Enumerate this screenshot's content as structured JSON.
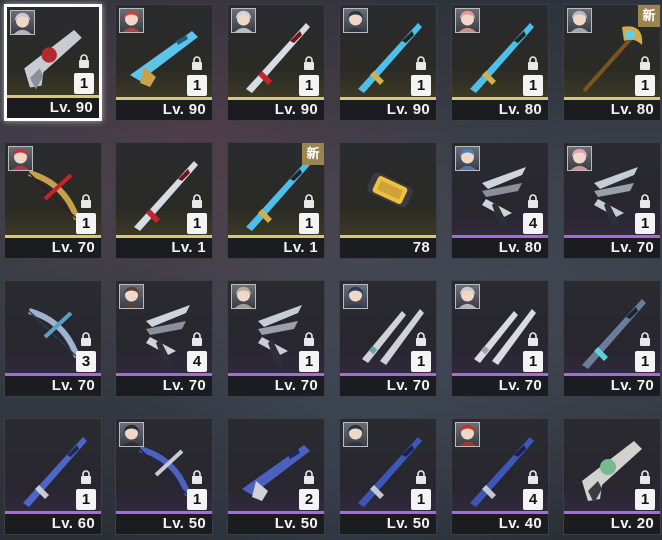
{
  "inventory": {
    "items": [
      {
        "level": "Lv. 90",
        "count": "1",
        "locked": true,
        "rarity": "gold",
        "weapon": "revolver-red",
        "avatar": "female-white",
        "avatar_color": "#c8c8d0",
        "selected": true,
        "new": false
      },
      {
        "level": "Lv. 90",
        "count": "1",
        "locked": true,
        "rarity": "gold",
        "weapon": "rifle-cyan",
        "avatar": "female-red",
        "avatar_color": "#c0463a",
        "selected": false,
        "new": false
      },
      {
        "level": "Lv. 90",
        "count": "1",
        "locked": true,
        "rarity": "gold",
        "weapon": "sword-red",
        "avatar": "female-silver",
        "avatar_color": "#cfd2d8",
        "selected": false,
        "new": false
      },
      {
        "level": "Lv. 90",
        "count": "1",
        "locked": true,
        "rarity": "gold",
        "weapon": "spear-cyan",
        "avatar": "male-dark",
        "avatar_color": "#2c3446",
        "selected": false,
        "new": false
      },
      {
        "level": "Lv. 80",
        "count": "1",
        "locked": true,
        "rarity": "gold",
        "weapon": "spear-cyan",
        "avatar": "female-pink",
        "avatar_color": "#e59a98",
        "selected": false,
        "new": false
      },
      {
        "level": "Lv. 80",
        "count": "1",
        "locked": true,
        "rarity": "gold",
        "weapon": "staff-gold",
        "avatar": "female-grey",
        "avatar_color": "#b9b9c0",
        "selected": false,
        "new": true
      },
      {
        "level": "Lv. 70",
        "count": "1",
        "locked": true,
        "rarity": "gold",
        "weapon": "bow-red-gold",
        "avatar": "female-red",
        "avatar_color": "#c0383a",
        "selected": false,
        "new": false
      },
      {
        "level": "Lv. 1",
        "count": "1",
        "locked": true,
        "rarity": "gold",
        "weapon": "sword-red",
        "avatar": "",
        "avatar_color": "",
        "selected": false,
        "new": false
      },
      {
        "level": "Lv. 1",
        "count": "1",
        "locked": true,
        "rarity": "gold",
        "weapon": "spear-cyan",
        "avatar": "",
        "avatar_color": "",
        "selected": false,
        "new": true
      },
      {
        "level": "78",
        "count": "",
        "locked": false,
        "rarity": "gold",
        "weapon": "capsule-gold",
        "avatar": "",
        "avatar_color": "",
        "selected": false,
        "new": false
      },
      {
        "level": "Lv. 80",
        "count": "4",
        "locked": true,
        "rarity": "purple",
        "weapon": "claw-silver",
        "avatar": "female-blue",
        "avatar_color": "#4d7fbf",
        "selected": false,
        "new": false
      },
      {
        "level": "Lv. 70",
        "count": "1",
        "locked": true,
        "rarity": "purple",
        "weapon": "drone-silver",
        "avatar": "female-pink",
        "avatar_color": "#e0a4b0",
        "selected": false,
        "new": false
      },
      {
        "level": "Lv. 70",
        "count": "3",
        "locked": true,
        "rarity": "purple",
        "weapon": "bow-blue",
        "avatar": "",
        "avatar_color": "",
        "selected": false,
        "new": false
      },
      {
        "level": "Lv. 70",
        "count": "4",
        "locked": true,
        "rarity": "purple",
        "weapon": "claw-silver",
        "avatar": "male-brown",
        "avatar_color": "#5a4034",
        "selected": false,
        "new": false
      },
      {
        "level": "Lv. 70",
        "count": "1",
        "locked": true,
        "rarity": "purple",
        "weapon": "drone-silver",
        "avatar": "male-light",
        "avatar_color": "#b8aaa0",
        "selected": false,
        "new": false
      },
      {
        "level": "Lv. 70",
        "count": "1",
        "locked": true,
        "rarity": "purple",
        "weapon": "dual-blades",
        "avatar": "male-navy",
        "avatar_color": "#2a3a5a",
        "selected": false,
        "new": false
      },
      {
        "level": "Lv. 70",
        "count": "1",
        "locked": true,
        "rarity": "purple",
        "weapon": "dual-blades-long",
        "avatar": "female-silver",
        "avatar_color": "#c9c9d0",
        "selected": false,
        "new": false
      },
      {
        "level": "Lv. 70",
        "count": "1",
        "locked": true,
        "rarity": "purple",
        "weapon": "blade-dark",
        "avatar": "",
        "avatar_color": "",
        "selected": false,
        "new": false
      },
      {
        "level": "Lv. 60",
        "count": "1",
        "locked": true,
        "rarity": "purple",
        "weapon": "spear-blue",
        "avatar": "",
        "avatar_color": "",
        "selected": false,
        "new": false
      },
      {
        "level": "Lv. 50",
        "count": "1",
        "locked": true,
        "rarity": "purple",
        "weapon": "crossbow-blue",
        "avatar": "male-black",
        "avatar_color": "#2a2a2e",
        "selected": false,
        "new": false
      },
      {
        "level": "Lv. 50",
        "count": "2",
        "locked": true,
        "rarity": "purple",
        "weapon": "rifle-blue",
        "avatar": "",
        "avatar_color": "",
        "selected": false,
        "new": false
      },
      {
        "level": "Lv. 50",
        "count": "1",
        "locked": true,
        "rarity": "purple",
        "weapon": "polearm-blue",
        "avatar": "male-dark",
        "avatar_color": "#2b3040",
        "selected": false,
        "new": false
      },
      {
        "level": "Lv. 40",
        "count": "4",
        "locked": true,
        "rarity": "purple",
        "weapon": "polearm-blue",
        "avatar": "female-red",
        "avatar_color": "#c0302c",
        "selected": false,
        "new": false
      },
      {
        "level": "Lv. 20",
        "count": "1",
        "locked": true,
        "rarity": "purple",
        "weapon": "pistol-white",
        "avatar": "",
        "avatar_color": "",
        "selected": false,
        "new": false
      }
    ],
    "new_badge_label": "新"
  },
  "colors": {
    "gold_bar": "#d9c772",
    "purple_bar": "#a46bd9",
    "selected_border": "#ffffff"
  }
}
